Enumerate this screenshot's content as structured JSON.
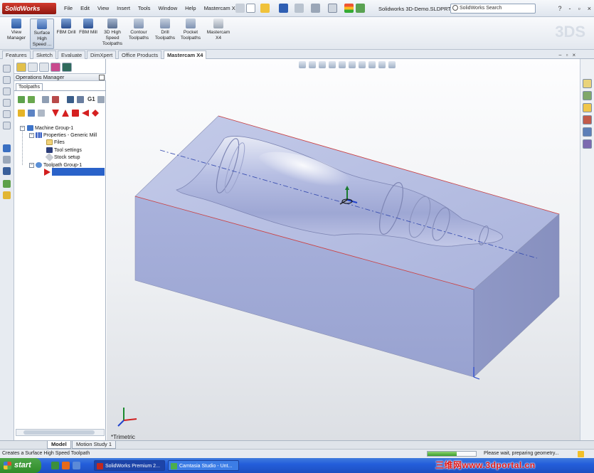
{
  "app": {
    "logo_text": "SolidWorks",
    "menu": [
      "File",
      "Edit",
      "View",
      "Insert",
      "Tools",
      "Window",
      "Help",
      "Mastercam X4"
    ],
    "doc_title": "Solidworks 3D-Demo.SLDPRT",
    "search_placeholder": "SolidWorks Search",
    "window_controls": [
      "?",
      "-",
      "▫",
      "×"
    ]
  },
  "command_manager": {
    "items": [
      {
        "label": "View\nManager"
      },
      {
        "label": "Surface\nHigh\nSpeed ..."
      },
      {
        "label": "FBM Drill"
      },
      {
        "label": "FBM Mill"
      },
      {
        "label": "3D High\nSpeed\nToolpaths"
      },
      {
        "label": "Contour\nToolpaths"
      },
      {
        "label": "Drill\nToolpaths"
      },
      {
        "label": "Pocket\nToolpaths"
      },
      {
        "label": "Mastercam\nX4"
      }
    ]
  },
  "tabs": [
    "Features",
    "Sketch",
    "Evaluate",
    "DimXpert",
    "Office Products",
    "Mastercam X4"
  ],
  "active_tab": "Mastercam X4",
  "panel": {
    "header": "Operations Manager",
    "subtab": "Toolpaths",
    "toolbar_text": "G1",
    "tree": [
      {
        "label": "Machine Group-1"
      },
      {
        "label": "Properties - Generic Mill"
      },
      {
        "label": "Files"
      },
      {
        "label": "Tool settings"
      },
      {
        "label": "Stock setup"
      },
      {
        "label": "Toolpath Group-1"
      }
    ]
  },
  "viewport": {
    "view_label": "*Trimetric"
  },
  "model_tabs": [
    "Model",
    "Motion Study 1"
  ],
  "active_model_tab": "Model",
  "status": {
    "message": "Creates a Surface High Speed Toolpath",
    "right_message": "Please wait, preparing geometry...",
    "progress": 0.6
  },
  "taskbar": {
    "start_label": "start",
    "buttons": [
      "SolidWorks Premium 2...",
      "Camtasia Studio - Unt..."
    ]
  },
  "watermark": "三维网www.3dportal.cn",
  "colors": {
    "part_face": "#a7b1d9",
    "part_top": "#b9c1e4",
    "selection_blue": "#2a62c9",
    "solidworks_red": "#c0281f"
  }
}
